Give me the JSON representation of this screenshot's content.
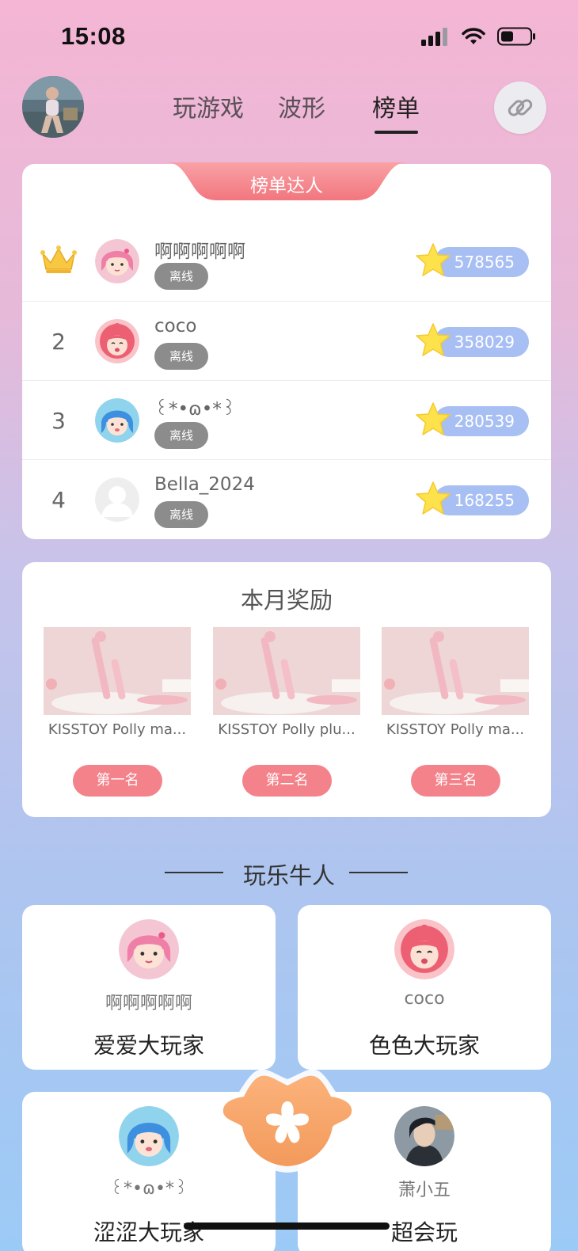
{
  "status_bar": {
    "time": "15:08"
  },
  "header": {
    "tabs": [
      {
        "label": "玩游戏"
      },
      {
        "label": "波形"
      },
      {
        "label": "榜单"
      }
    ],
    "active_tab": "榜单"
  },
  "leaderboard": {
    "banner": "榜单达人",
    "rows": [
      {
        "rank": "",
        "name": "啊啊啊啊啊",
        "status": "离线",
        "score": "578565"
      },
      {
        "rank": "2",
        "name": "coco",
        "status": "离线",
        "score": "358029"
      },
      {
        "rank": "3",
        "name": "꒰*•ɷ•*꒱",
        "status": "离线",
        "score": "280539"
      },
      {
        "rank": "4",
        "name": "Bella_2024",
        "status": "离线",
        "score": "168255"
      }
    ]
  },
  "rewards": {
    "title": "本月奖励",
    "items": [
      {
        "name": "KISSTOY Polly ma...",
        "place": "第一名"
      },
      {
        "name": "KISSTOY Polly plu...",
        "place": "第二名"
      },
      {
        "name": "KISSTOY Polly ma...",
        "place": "第三名"
      }
    ]
  },
  "players_section": {
    "title": "玩乐牛人",
    "cards": [
      {
        "name": "啊啊啊啊啊",
        "title": "爱爱大玩家"
      },
      {
        "name": "coco",
        "title": "色色大玩家"
      },
      {
        "name": "꒰*•ɷ•*꒱",
        "title": "涩涩大玩家"
      },
      {
        "name": "萧小五",
        "title": "超会玩"
      }
    ]
  },
  "colors": {
    "accent_pink": "#f3828a",
    "score_blue": "#a8bff3",
    "status_gray": "#8c8c8c",
    "fab_orange": "#f5a36a"
  }
}
